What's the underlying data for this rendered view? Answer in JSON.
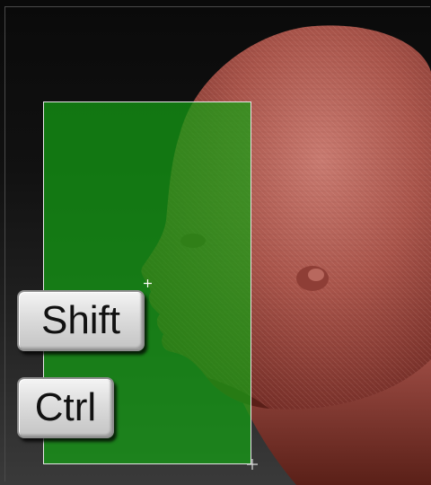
{
  "viewport": {
    "background": "#111111",
    "frame_color": "#4a4a4a"
  },
  "model": {
    "icon": "head-mesh",
    "color": "#b85a50"
  },
  "selection": {
    "color": "#14a014",
    "border_color": "#e8e8e8"
  },
  "keys": {
    "shift_label": "Shift",
    "ctrl_label": "Ctrl"
  },
  "cursor": {
    "icon": "crosshair-icon",
    "drag_icon": "drag-handle-icon"
  }
}
